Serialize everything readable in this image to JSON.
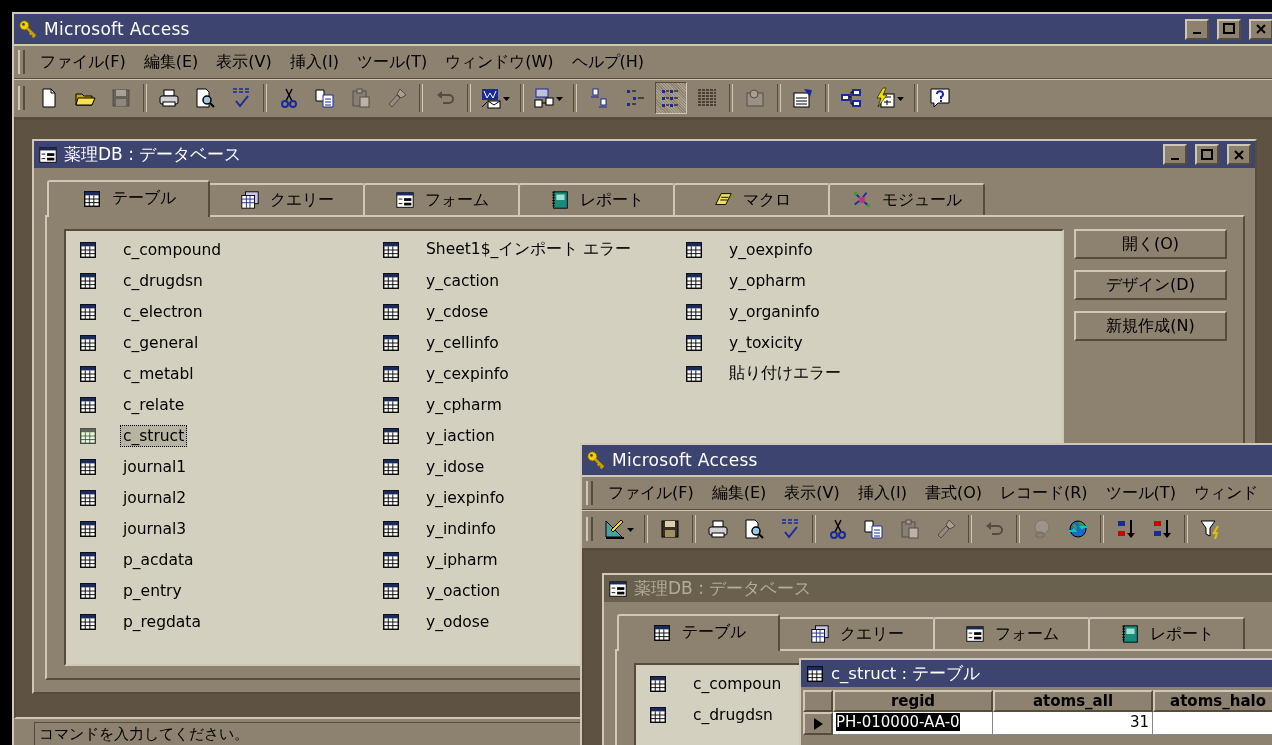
{
  "main_window": {
    "title": "Microsoft Access",
    "active": true,
    "menu": [
      "ファイル(F)",
      "編集(E)",
      "表示(V)",
      "挿入(I)",
      "ツール(T)",
      "ウィンドウ(W)",
      "ヘルプ(H)"
    ],
    "toolbar": [
      {
        "kind": "button",
        "disabled": false
      },
      {
        "kind": "button",
        "disabled": false
      },
      {
        "kind": "button",
        "disabled": true
      },
      {
        "kind": "separator"
      },
      {
        "kind": "button",
        "disabled": false
      },
      {
        "kind": "button",
        "disabled": false
      },
      {
        "kind": "button",
        "disabled": false
      },
      {
        "kind": "separator"
      },
      {
        "kind": "button",
        "disabled": false
      },
      {
        "kind": "button",
        "disabled": false
      },
      {
        "kind": "button",
        "disabled": true
      },
      {
        "kind": "button",
        "disabled": true
      },
      {
        "kind": "separator"
      },
      {
        "kind": "button",
        "disabled": true
      },
      {
        "kind": "separator"
      },
      {
        "kind": "dropdown",
        "disabled": false
      },
      {
        "kind": "separator"
      },
      {
        "kind": "dropdown",
        "disabled": false
      },
      {
        "kind": "separator"
      },
      {
        "kind": "view",
        "selected": false
      },
      {
        "kind": "view",
        "selected": false
      },
      {
        "kind": "view",
        "selected": true
      },
      {
        "kind": "view",
        "selected": false
      },
      {
        "kind": "separator"
      },
      {
        "kind": "button",
        "disabled": true
      },
      {
        "kind": "separator"
      },
      {
        "kind": "button",
        "disabled": false
      },
      {
        "kind": "separator"
      },
      {
        "kind": "button",
        "disabled": false
      },
      {
        "kind": "dropdown",
        "disabled": false
      },
      {
        "kind": "separator"
      },
      {
        "kind": "button",
        "disabled": false
      }
    ],
    "db_window": {
      "title": "薬理DB : データベース",
      "active": true,
      "tabs": [
        {
          "label": "テーブル",
          "selected": true
        },
        {
          "label": "クエリー",
          "selected": false
        },
        {
          "label": "フォーム",
          "selected": false
        },
        {
          "label": "レポート",
          "selected": false
        },
        {
          "label": "マクロ",
          "selected": false
        },
        {
          "label": "モジュール",
          "selected": false
        }
      ],
      "objects": [
        {
          "name": "c_compound",
          "selected": false
        },
        {
          "name": "c_drugdsn",
          "selected": false
        },
        {
          "name": "c_electron",
          "selected": false
        },
        {
          "name": "c_general",
          "selected": false
        },
        {
          "name": "c_metabl",
          "selected": false
        },
        {
          "name": "c_relate",
          "selected": false
        },
        {
          "name": "c_struct",
          "selected": true
        },
        {
          "name": "journal1",
          "selected": false
        },
        {
          "name": "journal2",
          "selected": false
        },
        {
          "name": "journal3",
          "selected": false
        },
        {
          "name": "p_acdata",
          "selected": false
        },
        {
          "name": "p_entry",
          "selected": false
        },
        {
          "name": "p_regdata",
          "selected": false
        },
        {
          "name": "Sheet1$_インポート エラー",
          "selected": false
        },
        {
          "name": "y_caction",
          "selected": false
        },
        {
          "name": "y_cdose",
          "selected": false
        },
        {
          "name": "y_cellinfo",
          "selected": false
        },
        {
          "name": "y_cexpinfo",
          "selected": false
        },
        {
          "name": "y_cpharm",
          "selected": false
        },
        {
          "name": "y_iaction",
          "selected": false
        },
        {
          "name": "y_idose",
          "selected": false
        },
        {
          "name": "y_iexpinfo",
          "selected": false
        },
        {
          "name": "y_indinfo",
          "selected": false
        },
        {
          "name": "y_ipharm",
          "selected": false
        },
        {
          "name": "y_oaction",
          "selected": false
        },
        {
          "name": "y_odose",
          "selected": false
        },
        {
          "name": "y_oexpinfo",
          "selected": false
        },
        {
          "name": "y_opharm",
          "selected": false
        },
        {
          "name": "y_organinfo",
          "selected": false
        },
        {
          "name": "y_toxicity",
          "selected": false
        },
        {
          "name": "貼り付けエラー",
          "selected": false
        }
      ],
      "buttons": [
        "開く(O)",
        "デザイン(D)",
        "新規作成(N)"
      ]
    },
    "status_bar": {
      "text": "コマンドを入力してください。"
    }
  },
  "second_window": {
    "title": "Microsoft Access",
    "active": true,
    "menu": [
      "ファイル(F)",
      "編集(E)",
      "表示(V)",
      "挿入(I)",
      "書式(O)",
      "レコード(R)",
      "ツール(T)",
      "ウィンド"
    ],
    "toolbar": [
      {
        "kind": "dropdown",
        "disabled": false
      },
      {
        "kind": "separator"
      },
      {
        "kind": "button",
        "disabled": false
      },
      {
        "kind": "separator"
      },
      {
        "kind": "button",
        "disabled": false
      },
      {
        "kind": "button",
        "disabled": false
      },
      {
        "kind": "button",
        "disabled": false
      },
      {
        "kind": "separator"
      },
      {
        "kind": "button",
        "disabled": false
      },
      {
        "kind": "button",
        "disabled": false
      },
      {
        "kind": "button",
        "disabled": true
      },
      {
        "kind": "button",
        "disabled": true
      },
      {
        "kind": "separator"
      },
      {
        "kind": "button",
        "disabled": true
      },
      {
        "kind": "separator"
      },
      {
        "kind": "button",
        "disabled": true
      },
      {
        "kind": "button",
        "disabled": false
      },
      {
        "kind": "separator"
      },
      {
        "kind": "button",
        "disabled": false
      },
      {
        "kind": "button",
        "disabled": false
      },
      {
        "kind": "separator"
      },
      {
        "kind": "button",
        "disabled": false
      }
    ],
    "db_window": {
      "title": "薬理DB : データベース",
      "active": false,
      "tabs": [
        {
          "label": "テーブル",
          "selected": true
        },
        {
          "label": "クエリー",
          "selected": false
        },
        {
          "label": "フォーム",
          "selected": false
        },
        {
          "label": "レポート",
          "selected": false
        }
      ],
      "objects": [
        {
          "name": "c_compoun",
          "selected": false
        },
        {
          "name": "c_drugdsn",
          "selected": false
        }
      ]
    },
    "table_window": {
      "title": "c_struct : テーブル",
      "active": true,
      "columns": [
        "regid",
        "atoms_all",
        "atoms_halo"
      ],
      "rows": [
        {
          "current": true,
          "cells": [
            {
              "text": "PH-010000-AA-0",
              "selected": true
            },
            {
              "text": "31",
              "selected": false
            }
          ]
        }
      ]
    }
  }
}
